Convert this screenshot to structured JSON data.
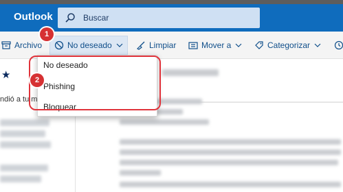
{
  "app": {
    "title": "Outlook"
  },
  "search": {
    "placeholder": "Buscar"
  },
  "toolbar": {
    "archive": "Archivo",
    "junk": "No deseado",
    "sweep": "Limpiar",
    "move": "Mover a",
    "categorize": "Categorizar"
  },
  "dropdown": {
    "items": [
      "No deseado",
      "Phishing",
      "Bloquear"
    ]
  },
  "callouts": {
    "one": "1",
    "two": "2"
  },
  "message_list": {
    "snippet": "ndió a tu mens"
  },
  "colors": {
    "header": "#0f6cbd",
    "accent": "#0f4e8a",
    "callout": "#d63133",
    "highlight": "#e0333b"
  }
}
